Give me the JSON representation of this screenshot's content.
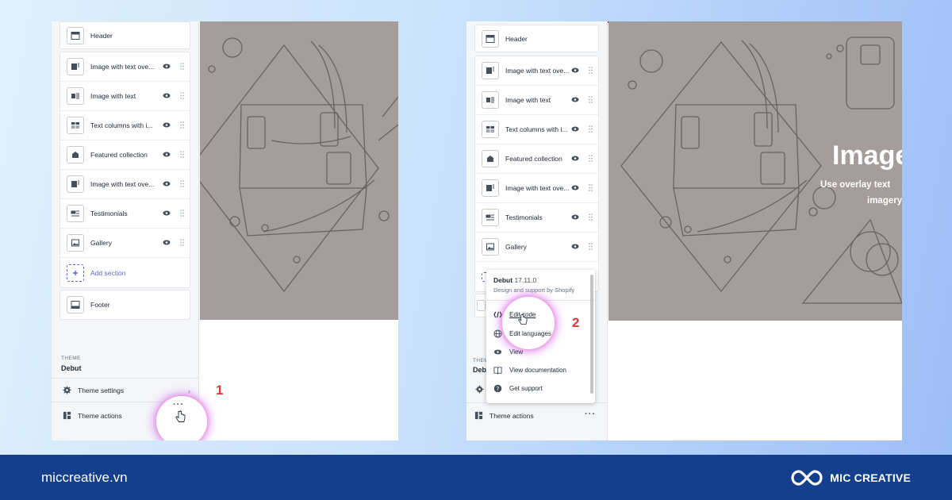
{
  "left_panel": {
    "header_section": {
      "label": "Header",
      "icon": "header-icon"
    },
    "sections": [
      {
        "label": "Image with text ove...",
        "icon": "image-overlay-icon"
      },
      {
        "label": "Image with text",
        "icon": "image-text-icon"
      },
      {
        "label": "Text columns with i...",
        "icon": "text-columns-icon"
      },
      {
        "label": "Featured collection",
        "icon": "collection-tag-icon"
      },
      {
        "label": "Image with text ove...",
        "icon": "image-overlay-icon"
      },
      {
        "label": "Testimonials",
        "icon": "quote-icon"
      },
      {
        "label": "Gallery",
        "icon": "gallery-icon"
      }
    ],
    "add_section": "Add section",
    "footer_section": "Footer",
    "theme_label": "THEME",
    "theme_name": "Debut",
    "theme_settings": "Theme settings",
    "theme_actions": "Theme actions",
    "step": "1"
  },
  "right_panel": {
    "header_section": {
      "label": "Header",
      "icon": "header-icon"
    },
    "sections": [
      {
        "label": "Image with text ove...",
        "icon": "image-overlay-icon"
      },
      {
        "label": "Image with text",
        "icon": "image-text-icon"
      },
      {
        "label": "Text columns with i...",
        "icon": "text-columns-icon"
      },
      {
        "label": "Featured collection",
        "icon": "collection-tag-icon"
      },
      {
        "label": "Image with text ove...",
        "icon": "image-overlay-icon"
      },
      {
        "label": "Testimonials",
        "icon": "quote-icon"
      },
      {
        "label": "Gallery",
        "icon": "gallery-icon"
      }
    ],
    "theme_label": "THEME",
    "theme_name": "Debut",
    "theme_actions": "Theme actions",
    "hero": {
      "title": "Image",
      "subtitle_line1": "Use overlay text",
      "subtitle_line2": "imagery"
    },
    "popup": {
      "theme_name": "Debut",
      "version": "17.11.0",
      "subtitle": "Design and support by Shopify",
      "items": [
        {
          "label": "Edit code",
          "icon": "code-icon"
        },
        {
          "label": "Edit languages",
          "icon": "globe-icon"
        },
        {
          "label": "View",
          "icon": "eye-icon"
        },
        {
          "label": "View documentation",
          "icon": "book-icon"
        },
        {
          "label": "Get support",
          "icon": "help-icon"
        }
      ]
    },
    "step": "2"
  },
  "footer": {
    "website": "miccreative.vn",
    "brand": "MIC CREATIVE"
  },
  "colors": {
    "accent": "#5c6ac4",
    "step": "#d93a37",
    "footer_bg": "#143f8c",
    "preview_bg": "#a59c9c"
  }
}
